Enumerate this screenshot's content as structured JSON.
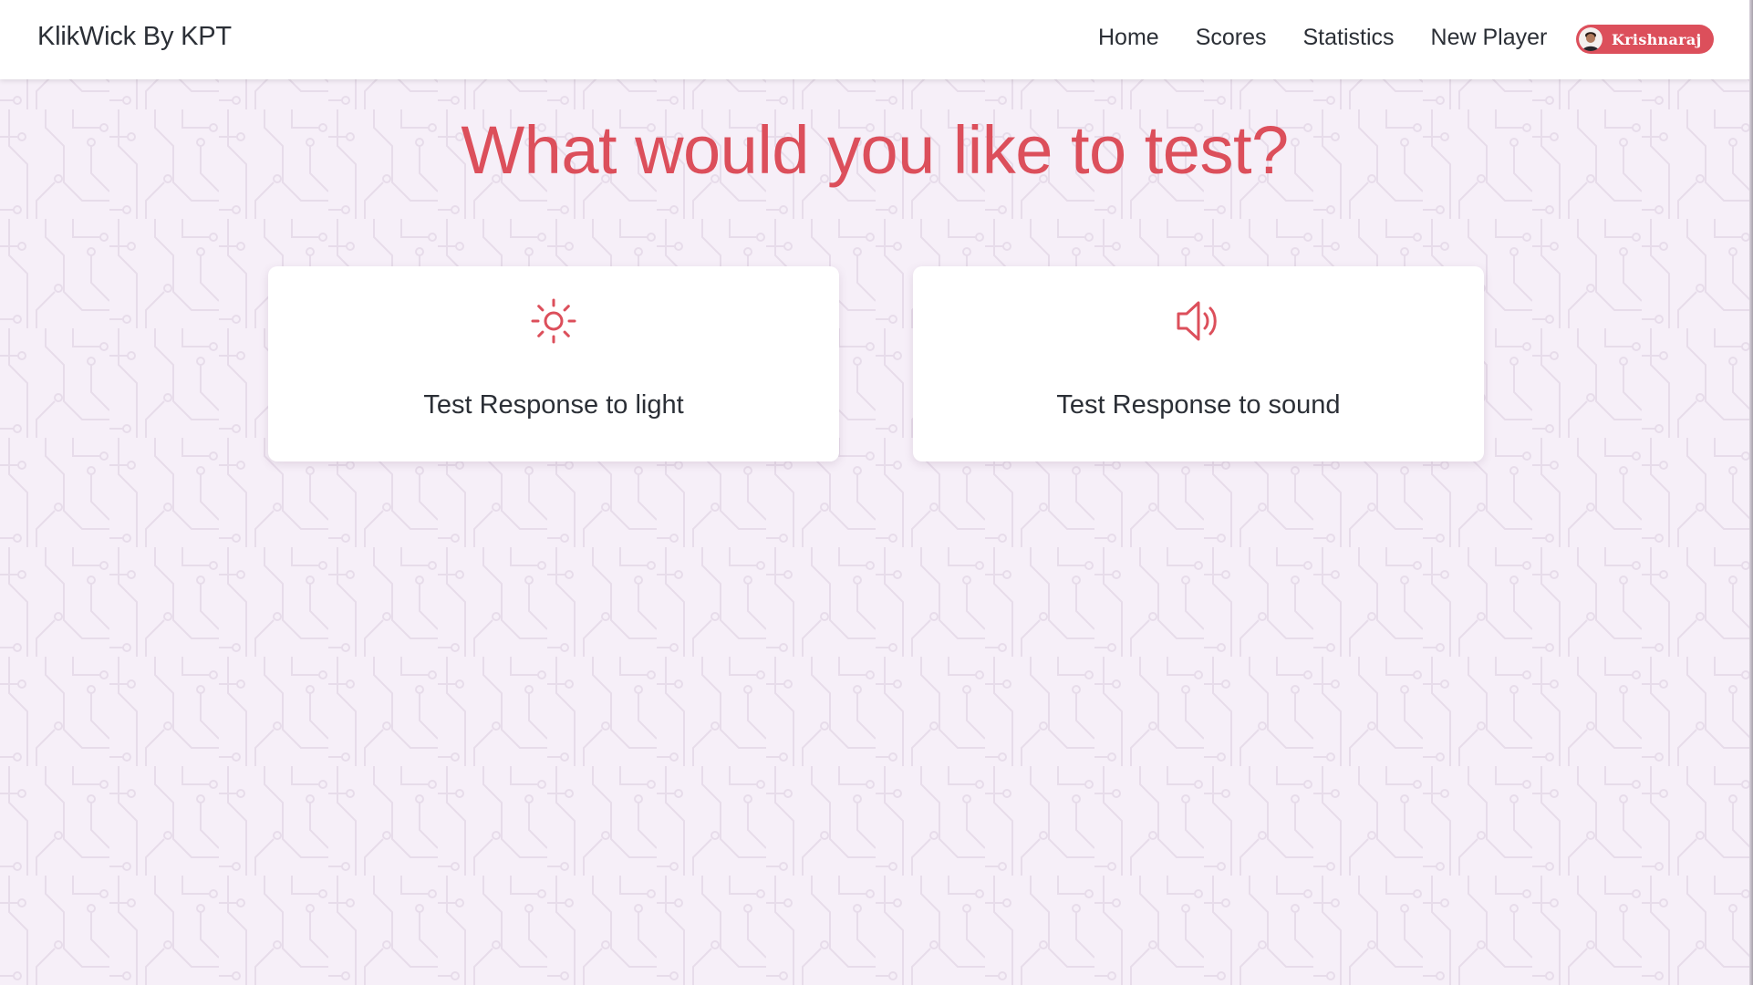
{
  "navbar": {
    "brand": "KlikWick By KPT",
    "links": [
      "Home",
      "Scores",
      "Statistics",
      "New Player"
    ],
    "user": {
      "name": "Krishnaraj",
      "avatar_icon": "user-avatar"
    }
  },
  "main": {
    "title": "What would you like to test?",
    "cards": [
      {
        "label": "Test Response to light",
        "icon": "sun-icon"
      },
      {
        "label": "Test Response to sound",
        "icon": "speaker-volume-icon"
      }
    ]
  },
  "colors": {
    "accent": "#dc4f5b",
    "background": "#f6eff8",
    "text": "#2b2f36"
  }
}
